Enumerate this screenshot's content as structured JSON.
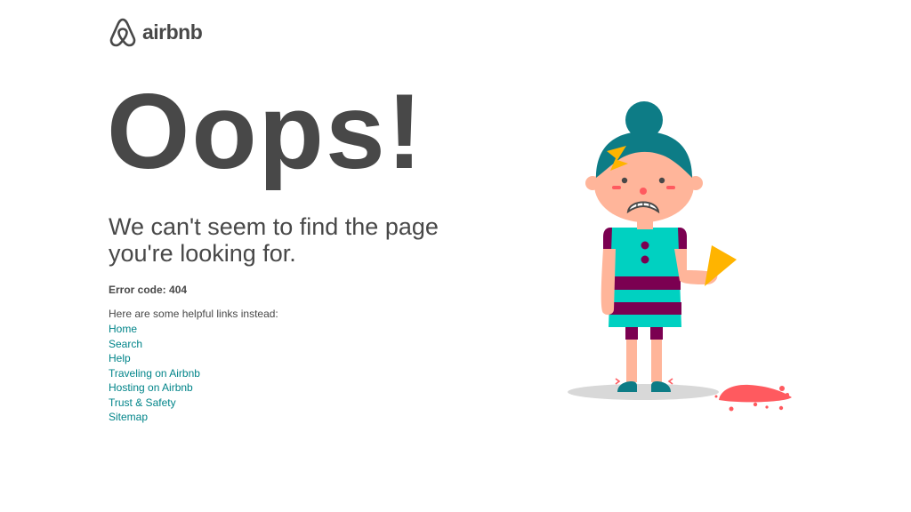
{
  "brand": {
    "logo_icon": "airbnb-belo-icon",
    "name": "airbnb"
  },
  "main": {
    "headline": "Oops!",
    "subhead": "We can't seem to find the page you're looking for.",
    "error_code": "Error code: 404",
    "links_intro": "Here are some helpful links instead:",
    "links": [
      {
        "label": "Home"
      },
      {
        "label": "Search"
      },
      {
        "label": "Help"
      },
      {
        "label": "Traveling on Airbnb"
      },
      {
        "label": "Hosting on Airbnb"
      },
      {
        "label": "Trust & Safety"
      },
      {
        "label": "Sitemap"
      }
    ]
  },
  "illustration": {
    "icon": "crying-girl-dropped-ice-cream-illustration"
  },
  "colors": {
    "text": "#484848",
    "link": "#008489",
    "teal": "#00A699",
    "hair": "#0D7C86",
    "plum": "#7B0051",
    "skin": "#FFB59A",
    "cone": "#FFB400",
    "ice_cream": "#FF5A5F"
  }
}
